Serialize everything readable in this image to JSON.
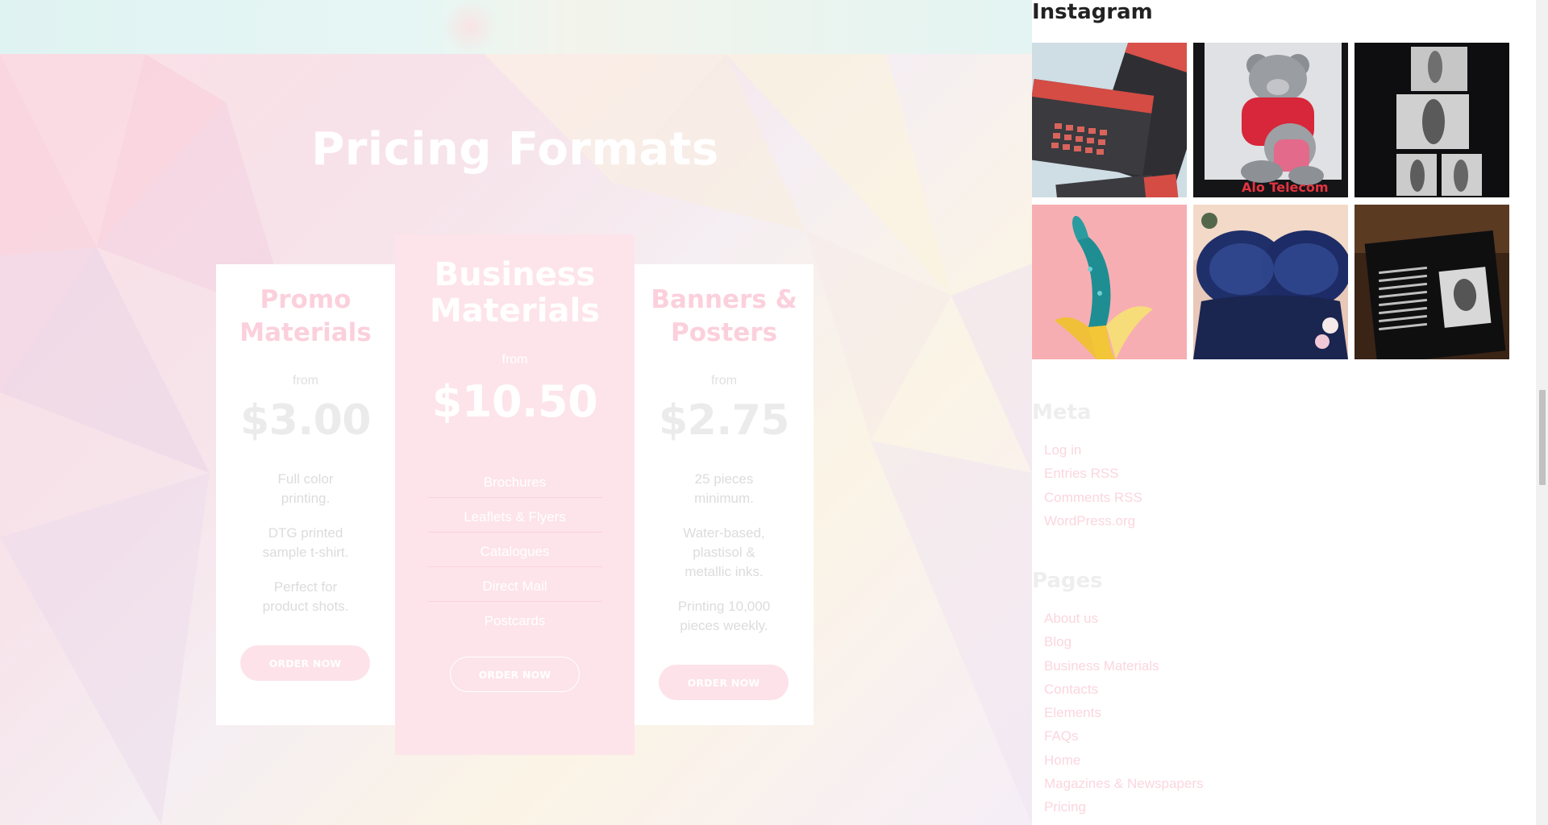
{
  "pricing": {
    "title": "Pricing Formats",
    "cards": [
      {
        "title_line1": "Promo",
        "title_line2": "Materials",
        "from": "from",
        "price": "$3.00",
        "features": [
          {
            "l1": "Full color",
            "l2": "printing."
          },
          {
            "l1": "DTG printed",
            "l2": "sample t-shirt."
          },
          {
            "l1": "Perfect for",
            "l2": "product shots."
          }
        ],
        "button": "ORDER NOW"
      },
      {
        "title_line1": "Business",
        "title_line2": "Materials",
        "from": "from",
        "price": "$10.50",
        "list": [
          "Brochures",
          "Leaflets & Flyers",
          "Catalogues",
          "Direct Mail",
          "Postcards"
        ],
        "button": "ORDER NOW"
      },
      {
        "title_line1": "Banners &",
        "title_line2": "Posters",
        "from": "from",
        "price": "$2.75",
        "features": [
          {
            "l1": "25 pieces",
            "l2": "minimum.",
            "l3": ""
          },
          {
            "l1": "Water-based,",
            "l2": "plastisol &",
            "l3": "metallic inks."
          },
          {
            "l1": "Printing 10,000",
            "l2": "pieces weekly.",
            "l3": ""
          }
        ],
        "button": "ORDER NOW"
      }
    ]
  },
  "sidebar": {
    "instagram_title": "Instagram",
    "meta_title": "Meta",
    "meta_links": [
      "Log in",
      "Entries RSS",
      "Comments RSS",
      "WordPress.org"
    ],
    "pages_title": "Pages",
    "pages_links": [
      "About us",
      "Blog",
      "Business Materials",
      "Contacts",
      "Elements",
      "FAQs",
      "Home",
      "Magazines & Newspapers",
      "Pricing"
    ],
    "instagram_images": [
      {
        "icon": "business-cards-photo"
      },
      {
        "icon": "teddy-bears-photo",
        "caption": "Alo Telecom"
      },
      {
        "icon": "bw-photo-prints-photo"
      },
      {
        "icon": "glitter-banana-photo"
      },
      {
        "icon": "lace-lingerie-photo"
      },
      {
        "icon": "open-magazine-photo"
      }
    ]
  },
  "colors": {
    "accent_pink": "#fde2e9",
    "title_pink": "#fbd0dc",
    "heading_dark": "#222222"
  }
}
